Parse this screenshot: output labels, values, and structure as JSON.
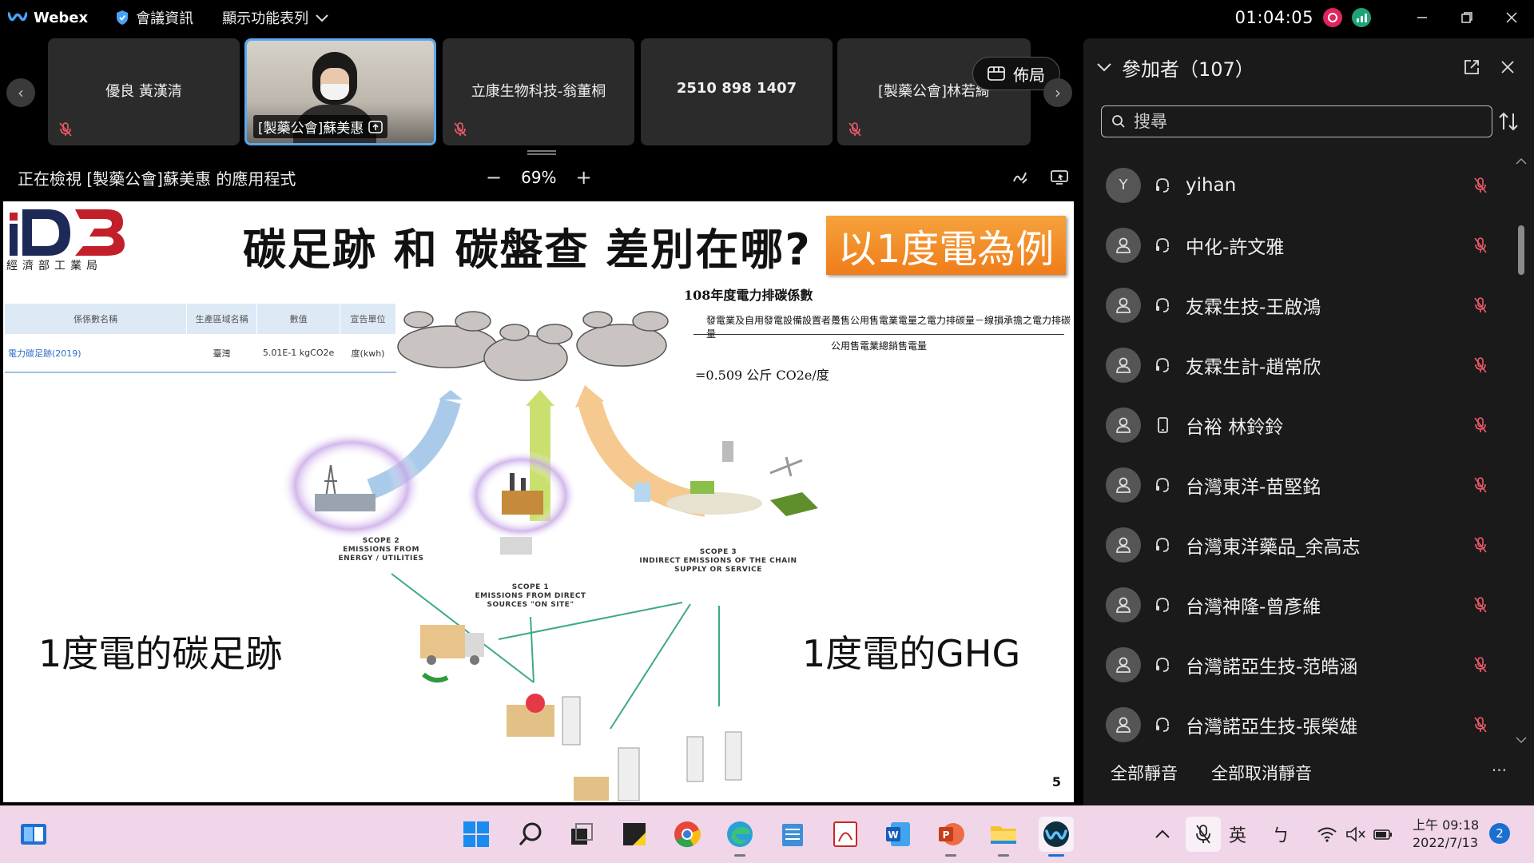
{
  "titlebar": {
    "brand": "Webex",
    "meeting_info": "會議資訊",
    "show_menu": "顯示功能表列",
    "timer": "01:04:05"
  },
  "strip": {
    "tiles": [
      {
        "name": "優良 黃漢清"
      },
      {
        "name": "[製藥公會]蘇美惠"
      },
      {
        "name": "立康生物科技-翁董桐"
      },
      {
        "name": "2510 898 1407"
      },
      {
        "name": "[製藥公會]林若綺"
      }
    ],
    "layout_label": "佈局"
  },
  "share_bar": {
    "viewing_text": "正在檢視 [製藥公會]蘇美惠 的應用程式",
    "zoom": "69%"
  },
  "slide": {
    "logo_sub": "經濟部工業局",
    "title": "碳足跡 和 碳盤查 差別在哪?",
    "badge": "以1度電為例",
    "table": {
      "headers": [
        "係係數名稱",
        "生產區域名稱",
        "數值",
        "宣告單位"
      ],
      "row": [
        "電力碳足跡(2019)",
        "臺灣",
        "5.01E-1 kgCO2e",
        "度(kwh)"
      ]
    },
    "formula": {
      "title": "108年度電力排碳係數",
      "numerator": "發電業及自用發電設備設置者躉售公用售電業電量之電力排碳量－線損承擔之電力排碳量",
      "denominator": "公用售電業總銷售電量",
      "result": "=0.509 公斤 CO2e/度"
    },
    "scope2": [
      "SCOPE 2",
      "EMISSIONS FROM",
      "ENERGY / UTILITIES"
    ],
    "scope1": [
      "SCOPE 1",
      "EMISSIONS FROM DIRECT",
      "SOURCES \"ON SITE\""
    ],
    "scope3": [
      "SCOPE 3",
      "INDIRECT EMISSIONS OF THE CHAIN",
      "SUPPLY OR SERVICE"
    ],
    "left_caption": "1度電的碳足跡",
    "right_caption": "1度電的GHG",
    "page": "5"
  },
  "panel": {
    "title": "參加者（107）",
    "search_placeholder": "搜尋",
    "participants": [
      {
        "avatar": "Y",
        "name": "yihan",
        "device": "headset"
      },
      {
        "avatar": "",
        "name": "中化-許文雅",
        "device": "headset"
      },
      {
        "avatar": "",
        "name": "友霖生技-王啟鴻",
        "device": "headset"
      },
      {
        "avatar": "",
        "name": "友霖生計-趙常欣",
        "device": "headset"
      },
      {
        "avatar": "",
        "name": "台裕 林鈴鈴",
        "device": "phone"
      },
      {
        "avatar": "",
        "name": "台灣東洋-苗堅銘",
        "device": "headset"
      },
      {
        "avatar": "",
        "name": "台灣東洋藥品_余高志",
        "device": "headset"
      },
      {
        "avatar": "",
        "name": "台灣神隆-曾彥維",
        "device": "headset"
      },
      {
        "avatar": "",
        "name": "台灣諾亞生技-范皓涵",
        "device": "headset"
      },
      {
        "avatar": "",
        "name": "台灣諾亞生技-張榮雄",
        "device": "headset"
      }
    ],
    "mute_all": "全部靜音",
    "unmute_all": "全部取消靜音",
    "more": "···"
  },
  "taskbar": {
    "ime_lang": "英",
    "ime_mode": "ㄅ",
    "time_line1": "上午 09:18",
    "time_line2": "2022/7/13",
    "notifications": "2"
  },
  "colors": {
    "accent_blue": "#5aa8f0",
    "record_red": "#e0245e",
    "mute_red": "#f05a6a",
    "badge_orange": "#ef7d1a",
    "taskbar_bg": "#f0d6e8"
  }
}
